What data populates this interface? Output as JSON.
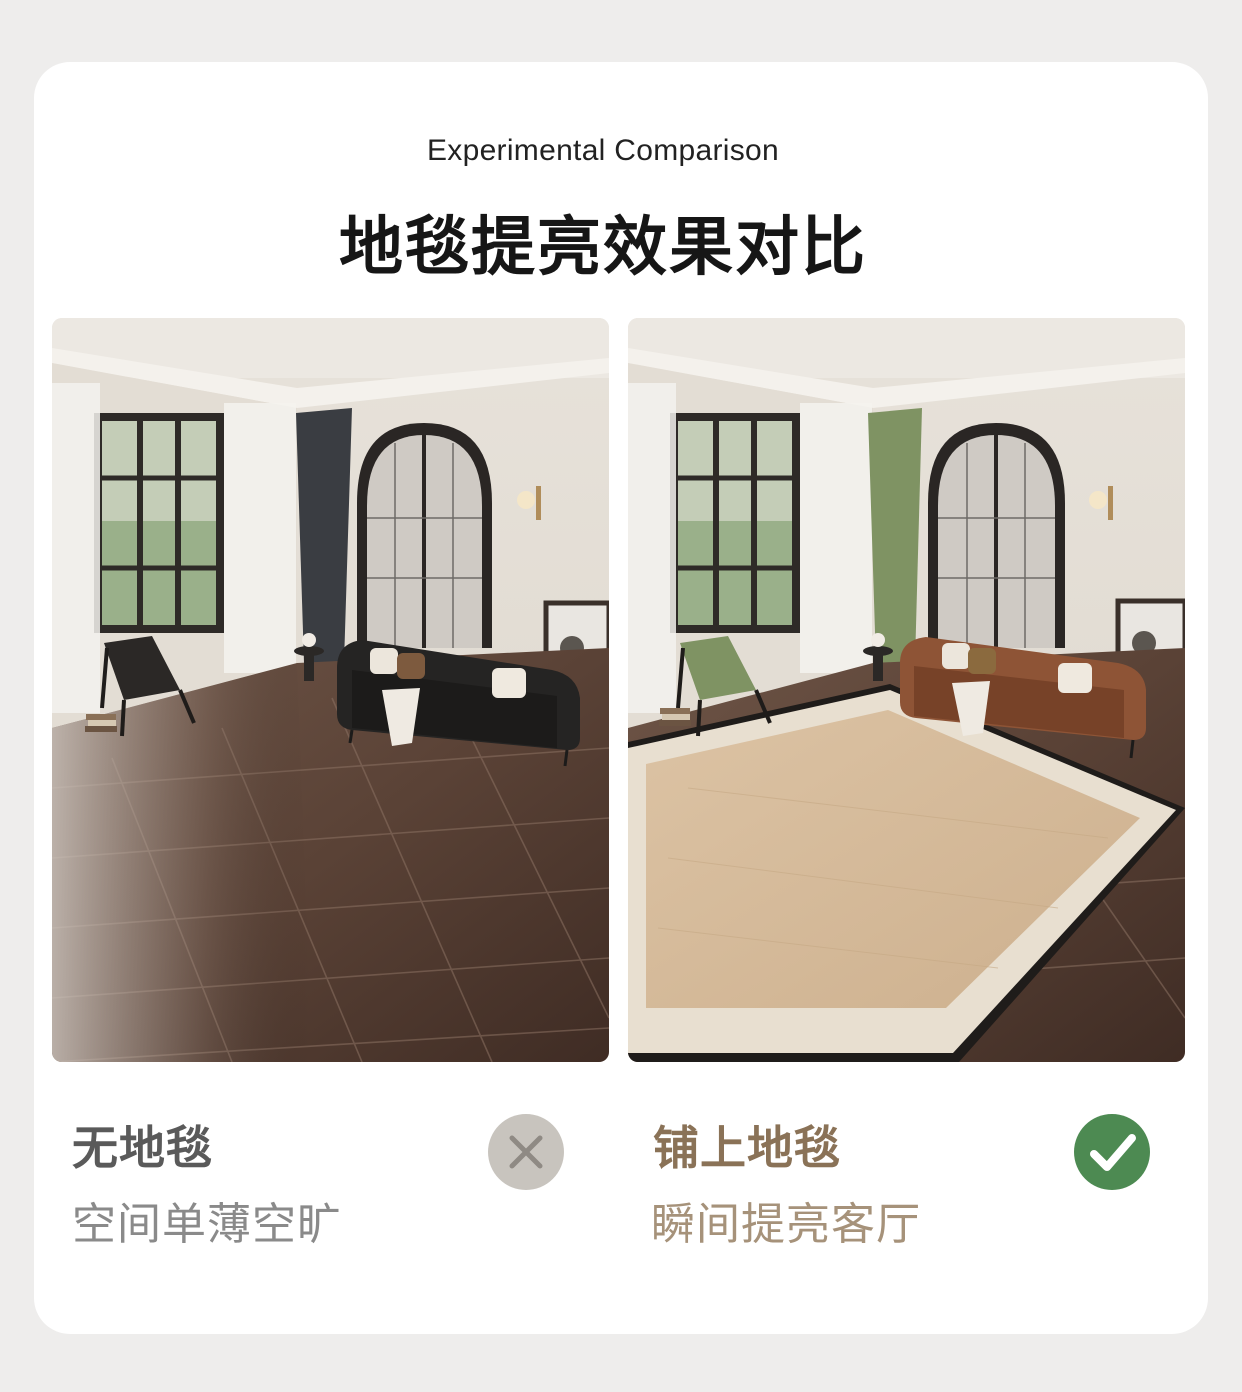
{
  "header": {
    "subtitle": "Experimental Comparison",
    "title": "地毯提亮效果对比"
  },
  "comparison": {
    "without": {
      "title": "无地毯",
      "description": "空间单薄空旷",
      "icon": "x-icon",
      "badge_color": "#c8c4be"
    },
    "with": {
      "title": "铺上地毯",
      "description": "瞬间提亮客厅",
      "icon": "check-icon",
      "badge_color": "#4d8a52"
    }
  },
  "colors": {
    "accent": "#8a7257",
    "muted": "#8a8a8a"
  }
}
